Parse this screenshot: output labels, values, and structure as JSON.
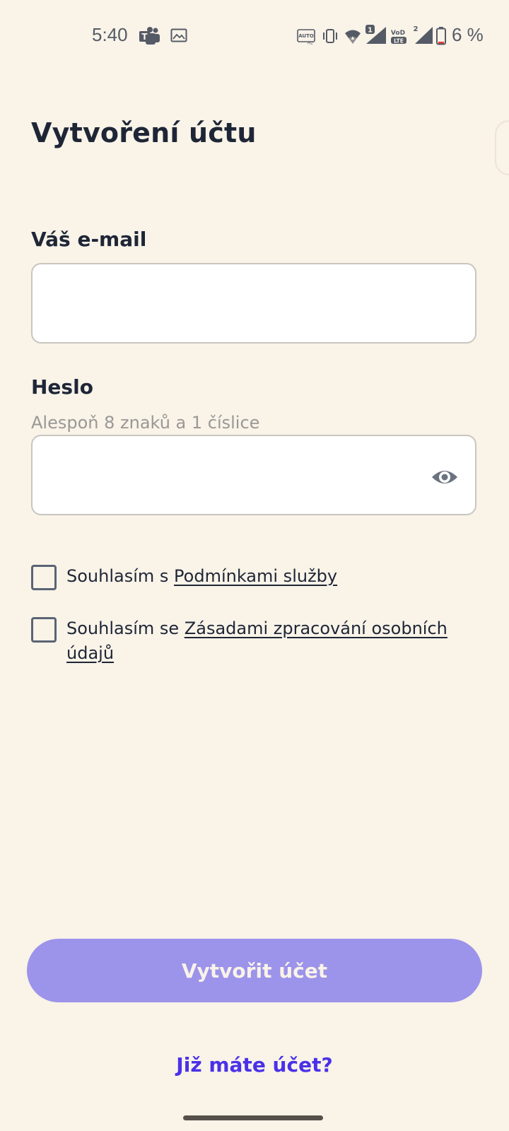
{
  "status_bar": {
    "time": "5:40",
    "battery": "6 %",
    "sim1_badge": "1",
    "sim2_badge": "2",
    "icons": [
      "teams-icon",
      "image-icon",
      "auto-hz-icon",
      "vibrate-icon",
      "wifi-icon",
      "signal-icon",
      "volte-icon",
      "signal-2-icon",
      "battery-icon"
    ]
  },
  "page": {
    "title": "Vytvoření účtu"
  },
  "email": {
    "label": "Váš e-mail",
    "value": "",
    "placeholder": ""
  },
  "password": {
    "label": "Heslo",
    "hint": "Alespoň 8 znaků a 1 číslice",
    "value": "",
    "placeholder": "",
    "toggle_icon": "eye-icon"
  },
  "consents": [
    {
      "prefix": "Souhlasím s ",
      "link": "Podmínkami služby",
      "checked": false
    },
    {
      "prefix": "Souhlasím se ",
      "link": "Zásadami zpracování osobních údajů",
      "checked": false
    }
  ],
  "actions": {
    "create_account": "Vytvořit účet",
    "login_link": "Již máte účet?"
  },
  "colors": {
    "background": "#f9f3e8",
    "primary_button": "#9c93ea",
    "link": "#4a31e8",
    "text": "#1e2636"
  }
}
